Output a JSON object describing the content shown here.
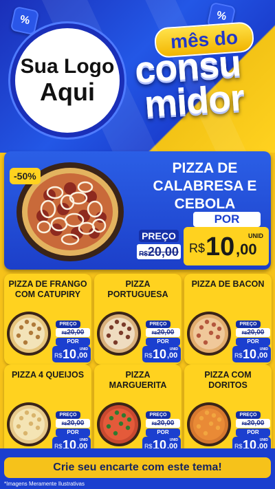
{
  "header": {
    "logo_line1": "Sua Logo",
    "logo_line2": "Aqui",
    "campaign_top": "mês do",
    "campaign_mid": "consu",
    "campaign_bot": "midor",
    "percent_icon": "%"
  },
  "featured": {
    "discount": "-50%",
    "title": "PIZZA DE CALABRESA E CEBOLA",
    "preco_label": "PREÇO",
    "old_currency": "R$",
    "old_price": "20,00",
    "por_label": "POR",
    "unid_label": "UNID",
    "currency": "R$",
    "price_int": "10",
    "price_dec": ",00"
  },
  "products": [
    {
      "name": "PIZZA DE FRANGO COM CATUPIRY",
      "preco_label": "PREÇO",
      "old_currency": "R$",
      "old_price": "20,00",
      "por_label": "POR",
      "unid_label": "UNID",
      "currency": "R$",
      "price_int": "10",
      "price_dec": ",00"
    },
    {
      "name": "PIZZA PORTUGUESA",
      "preco_label": "PREÇO",
      "old_currency": "R$",
      "old_price": "20,00",
      "por_label": "POR",
      "unid_label": "UNID",
      "currency": "R$",
      "price_int": "10",
      "price_dec": ",00"
    },
    {
      "name": "PIZZA DE BACON",
      "preco_label": "PREÇO",
      "old_currency": "R$",
      "old_price": "20,00",
      "por_label": "POR",
      "unid_label": "UNID",
      "currency": "R$",
      "price_int": "10",
      "price_dec": ",00"
    },
    {
      "name": "PIZZA 4 QUEIJOS",
      "preco_label": "PREÇO",
      "old_currency": "R$",
      "old_price": "20,00",
      "por_label": "POR",
      "unid_label": "UNID",
      "currency": "R$",
      "price_int": "10",
      "price_dec": ",00"
    },
    {
      "name": "PIZZA MARGUERITA",
      "preco_label": "PREÇO",
      "old_currency": "R$",
      "old_price": "20,00",
      "por_label": "POR",
      "unid_label": "UNID",
      "currency": "R$",
      "price_int": "10",
      "price_dec": ",00"
    },
    {
      "name": "PIZZA COM DORITOS",
      "preco_label": "PREÇO",
      "old_currency": "R$",
      "old_price": "20,00",
      "por_label": "POR",
      "unid_label": "UNID",
      "currency": "R$",
      "price_int": "10",
      "price_dec": ",00"
    }
  ],
  "footer": {
    "cta": "Crie seu encarte com este tema!",
    "disclaimer": "*Imagens Meramente Ilustrativas"
  },
  "colors": {
    "brand_blue": "#1b3fcf",
    "brand_yellow": "#ffd21f",
    "dark_blue": "#1530a8"
  }
}
